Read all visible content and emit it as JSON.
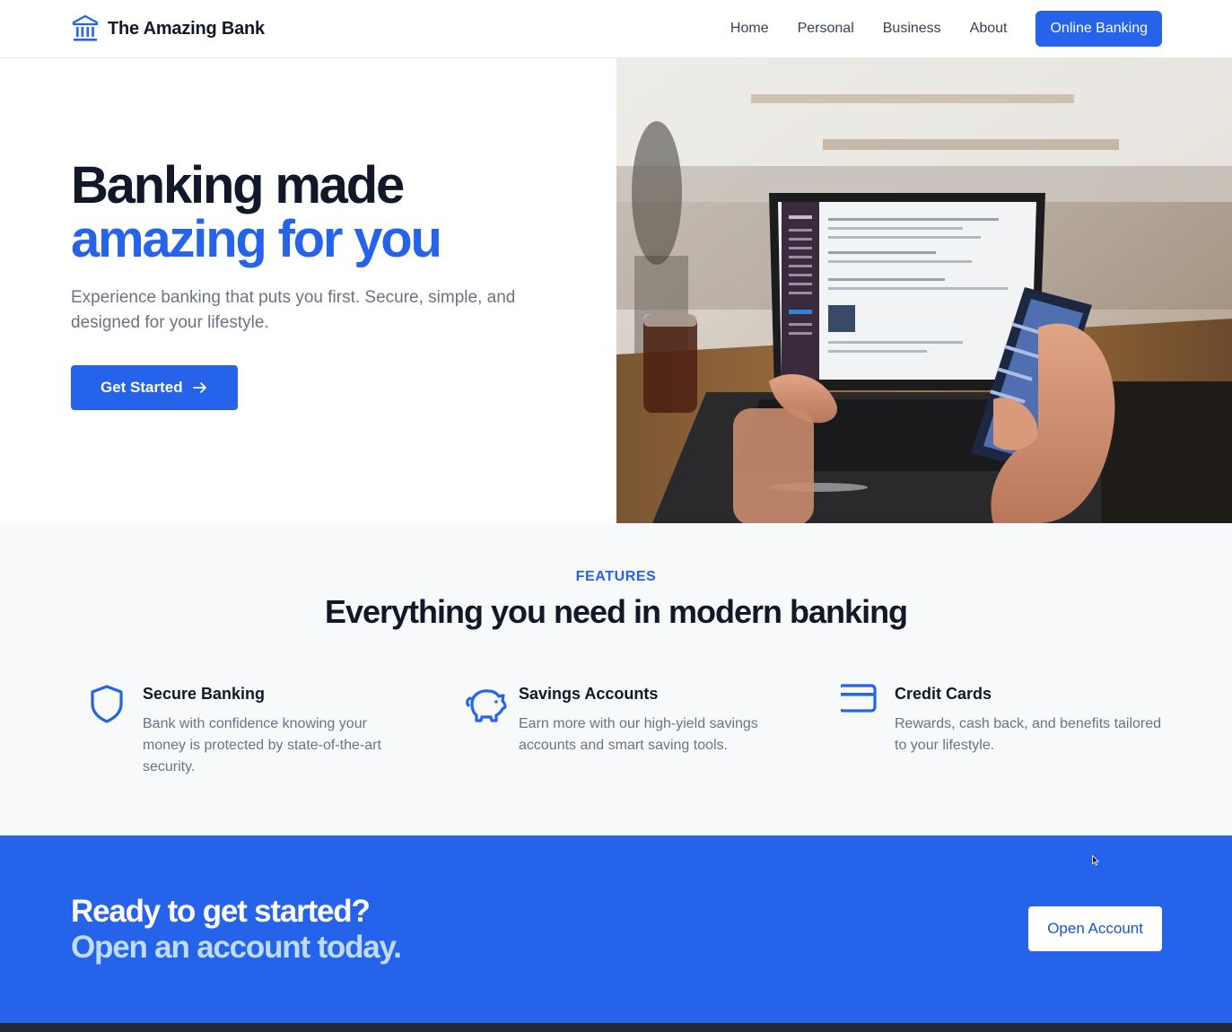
{
  "brand": {
    "name": "The Amazing Bank",
    "icon": "bank-icon"
  },
  "nav": {
    "links": [
      "Home",
      "Personal",
      "Business",
      "About"
    ],
    "cta": "Online Banking"
  },
  "hero": {
    "title_line1": "Banking made",
    "title_line2": "amazing for you",
    "subtitle": "Experience banking that puts you first. Secure, simple, and designed for your lifestyle.",
    "button": "Get Started",
    "button_icon": "arrow-right-icon",
    "image": "person-using-laptop-and-phone-photo"
  },
  "features": {
    "eyebrow": "FEATURES",
    "title": "Everything you need in modern banking",
    "items": [
      {
        "icon": "shield-icon",
        "title": "Secure Banking",
        "description": "Bank with confidence knowing your money is protected by state-of-the-art security."
      },
      {
        "icon": "piggy-bank-icon",
        "title": "Savings Accounts",
        "description": "Earn more with our high-yield savings accounts and smart saving tools."
      },
      {
        "icon": "credit-card-icon",
        "title": "Credit Cards",
        "description": "Rewards, cash back, and benefits tailored to your lifestyle."
      }
    ]
  },
  "cta": {
    "title_line1": "Ready to get started?",
    "title_line2": "Open an account today.",
    "button": "Open Account"
  },
  "colors": {
    "primary": "#2563eb",
    "text": "#111827",
    "muted": "#6b7280",
    "cta_light": "#bfdbfe",
    "features_bg": "#f8f9fb",
    "footer": "#1f2937"
  }
}
